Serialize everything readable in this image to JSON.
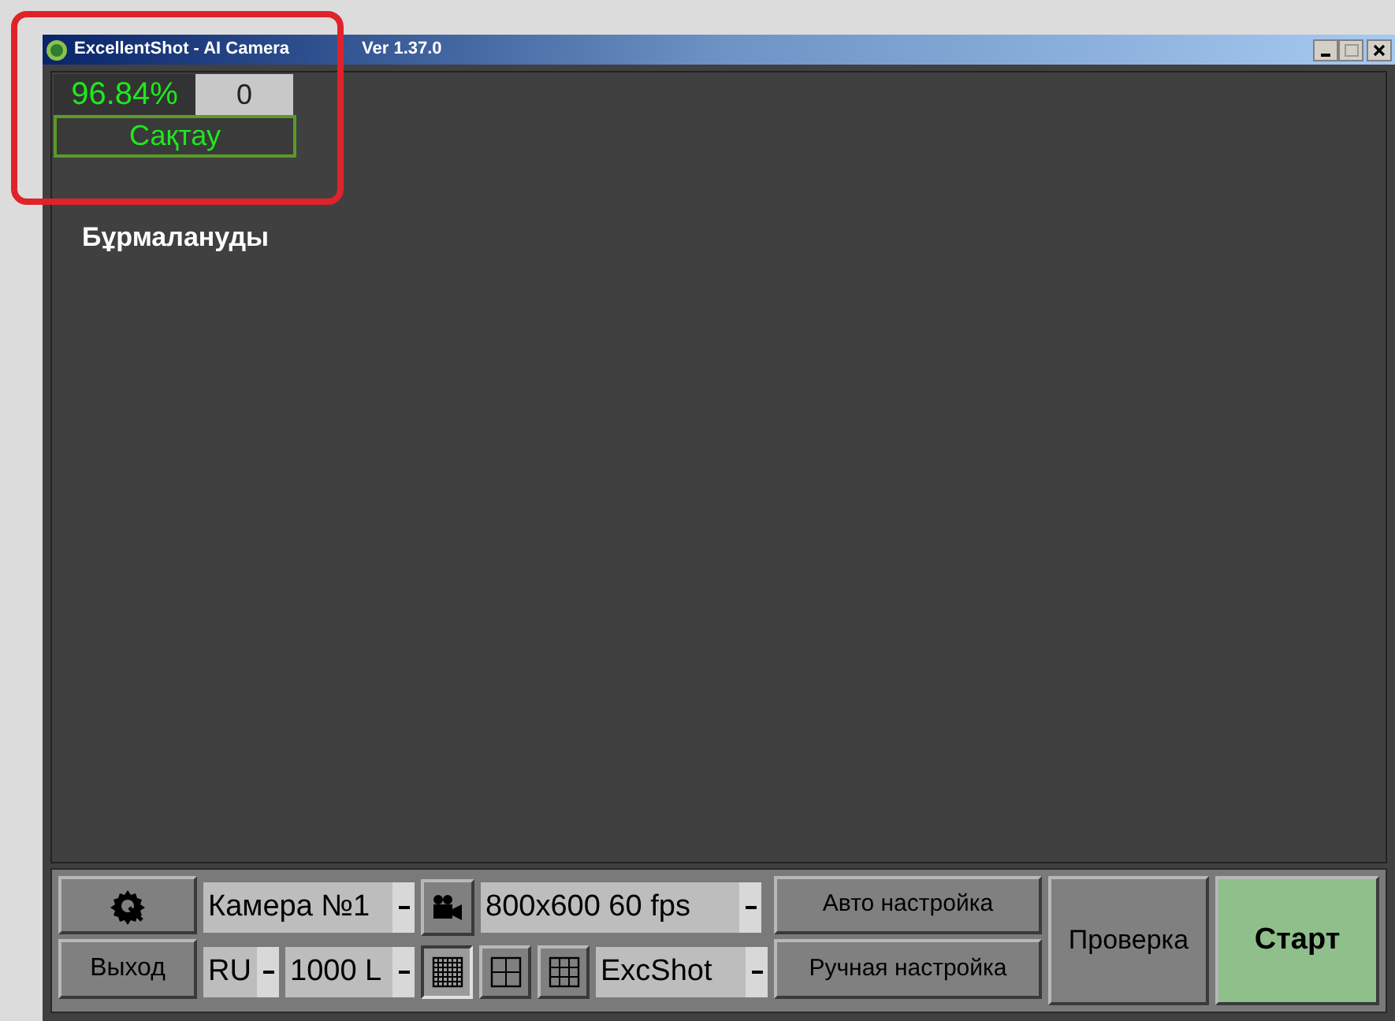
{
  "window": {
    "title": "ExcellentShot - AI Camera",
    "version": "Ver 1.37.0"
  },
  "overlay": {
    "score": "96.84%",
    "count": "0",
    "save_label": "Сақтау",
    "distortion_label": "Бұрмалануды"
  },
  "toolbar": {
    "exit": "Выход",
    "camera_select": {
      "value": "Камера №1"
    },
    "resolution_select": {
      "value": "800x600 60 fps"
    },
    "language_select": {
      "value": "RU"
    },
    "light_select": {
      "value": "1000 L"
    },
    "grid_buttons": [
      {
        "kind": "fine",
        "selected": true
      },
      {
        "kind": "quad",
        "selected": false
      },
      {
        "kind": "thirds",
        "selected": false
      }
    ],
    "mode_select": {
      "value": "ExcShot"
    },
    "auto_setup": "Авто настройка",
    "manual_setup": "Ручная настройка",
    "check": "Проверка",
    "start": "Старт"
  }
}
